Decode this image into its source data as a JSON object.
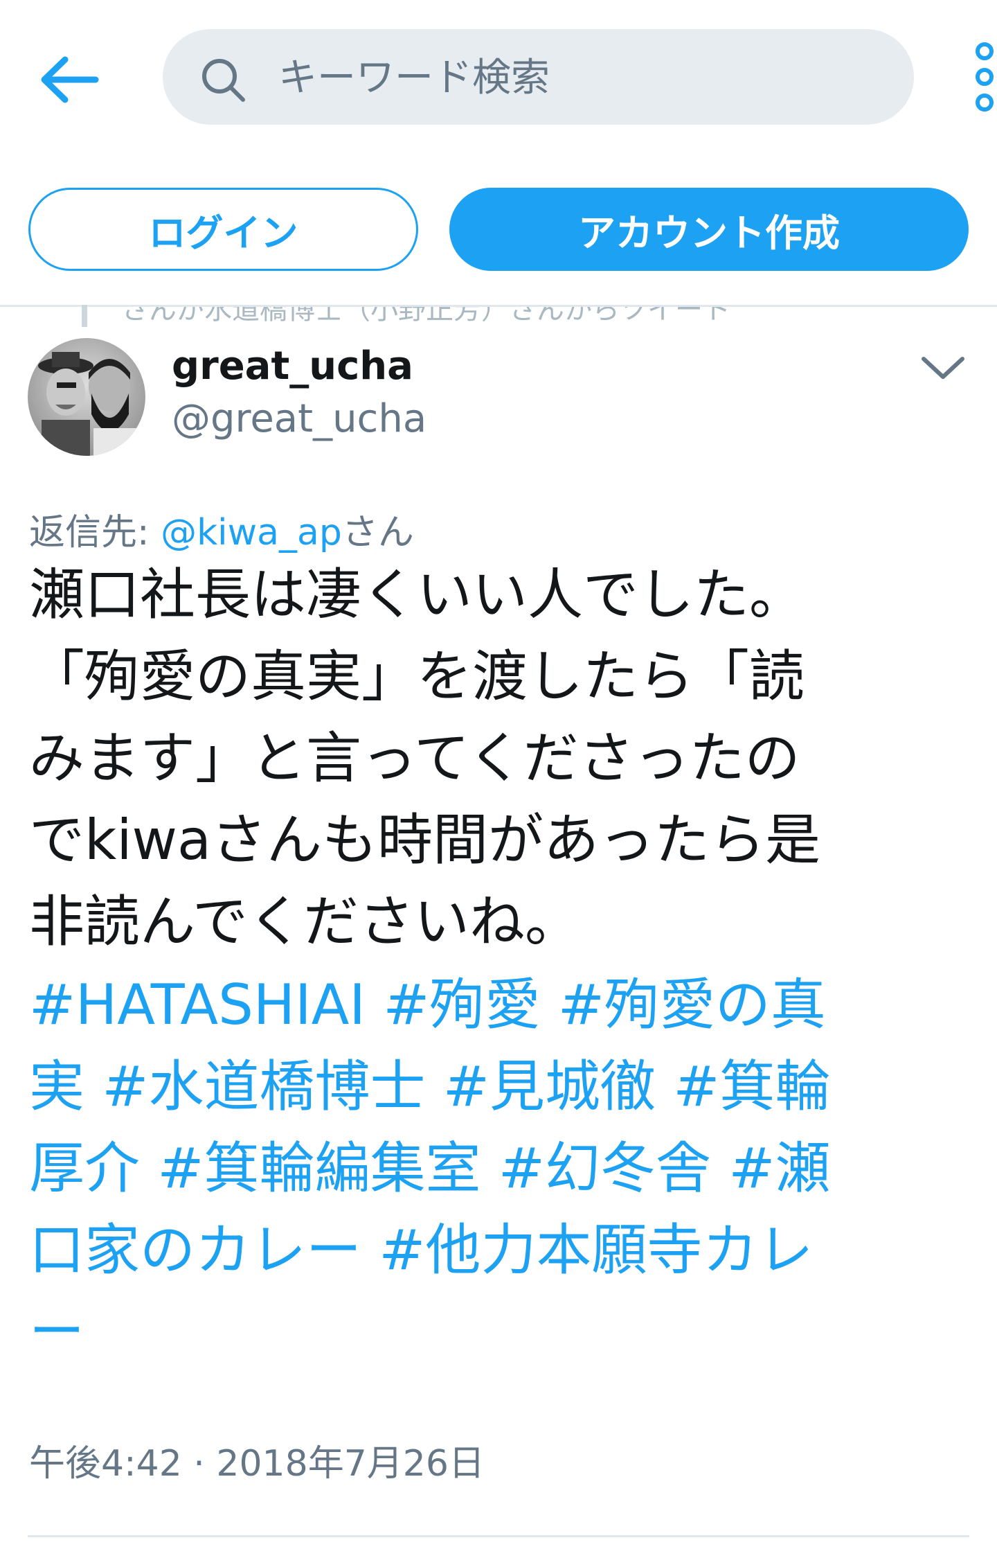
{
  "header": {
    "back_icon": "arrow-left-icon",
    "search_placeholder": "キーワード検索",
    "more_icon": "vertical-dots-icon"
  },
  "auth": {
    "login_label": "ログイン",
    "signup_label": "アカウント作成"
  },
  "context_line": "さんが水道橋博士（小野正芳）さんからツイート",
  "tweet": {
    "display_name": "great_ucha",
    "handle": "@great_ucha",
    "reply_prefix": "返信先: ",
    "reply_mention": "@kiwa_ap",
    "reply_suffix": "さん",
    "body_lines": [
      "瀬口社長は凄くいい人でした。",
      "「殉愛の真実」を渡したら「読",
      "みます」と言ってくださったの",
      "でkiwaさんも時間があったら是",
      "非読んでくださいね。"
    ],
    "hashtag_lines": [
      "#HATASHIAI #殉愛 #殉愛の真",
      "実 #水道橋博士 #見城徹 #箕輪",
      "厚介 #箕輪編集室 #幻冬舎 #瀬",
      "口家のカレー #他力本願寺カレ",
      "ー"
    ],
    "timestamp": "午後4:42 · 2018年7月26日"
  },
  "colors": {
    "accent": "#1da1f2",
    "text": "#14171a",
    "muted": "#657786",
    "search_bg": "#e6ecf0",
    "divider": "#e1e8ed"
  }
}
